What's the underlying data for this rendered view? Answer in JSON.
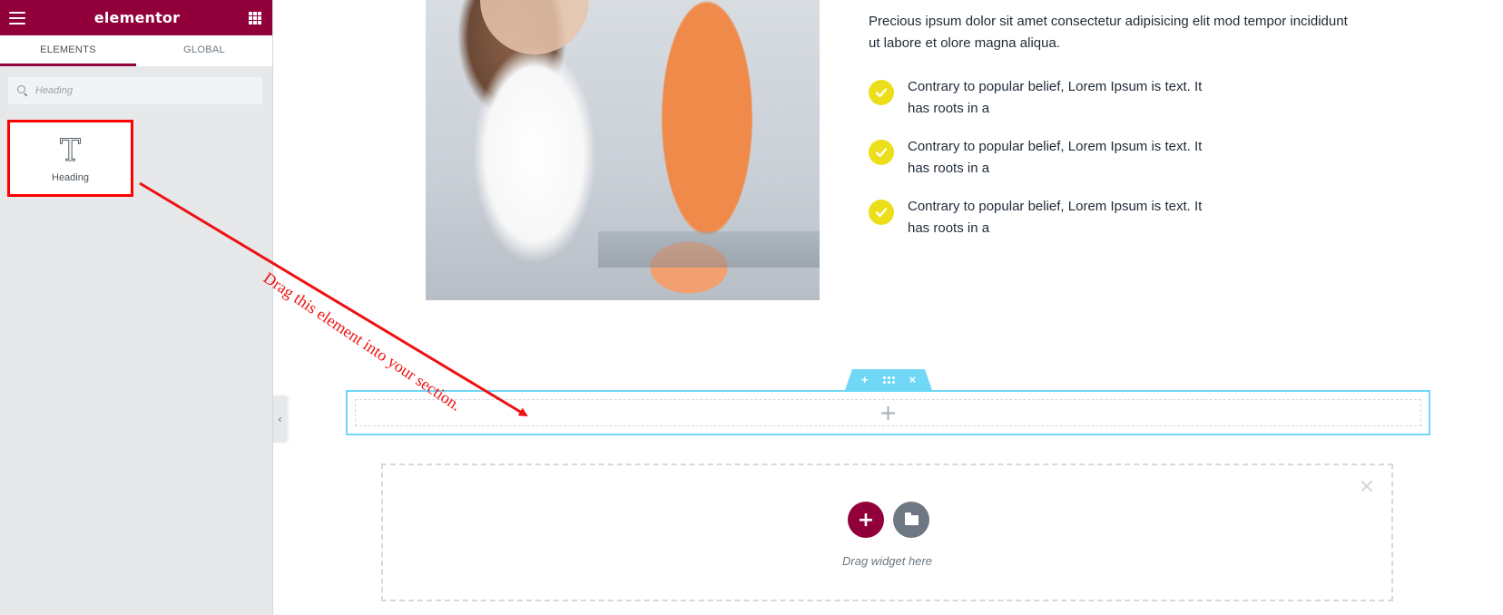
{
  "app": {
    "brand": "elementor"
  },
  "sidebar": {
    "tabs": [
      {
        "label": "ELEMENTS",
        "active": true
      },
      {
        "label": "GLOBAL",
        "active": false
      }
    ],
    "search": {
      "placeholder": "Heading",
      "value": ""
    },
    "widgets": [
      {
        "label": "Heading",
        "icon": "heading-icon"
      }
    ],
    "colors": {
      "brand": "#92003b",
      "highlight_border": "#ff0000"
    }
  },
  "content": {
    "intro": "Precious ipsum dolor sit amet consectetur adipisicing elit mod tempor incididunt ut labore et olore magna aliqua.",
    "features": [
      "Contrary to popular belief, Lorem Ipsum is text. It has roots in a",
      "Contrary to popular belief, Lorem Ipsum is text. It has roots in a",
      "Contrary to popular belief, Lorem Ipsum is text. It has roots in a"
    ],
    "check_color": "#ecdf1a"
  },
  "section_handle": {
    "add": "+",
    "move": "drag-handle-icon",
    "close": "×"
  },
  "empty_section": {
    "plus": "+"
  },
  "add_section": {
    "add_button": "+",
    "close": "✕",
    "drag_hint": "Drag widget here"
  },
  "annotation": {
    "text": "Drag this element into your section.",
    "color": "#ee1111"
  }
}
